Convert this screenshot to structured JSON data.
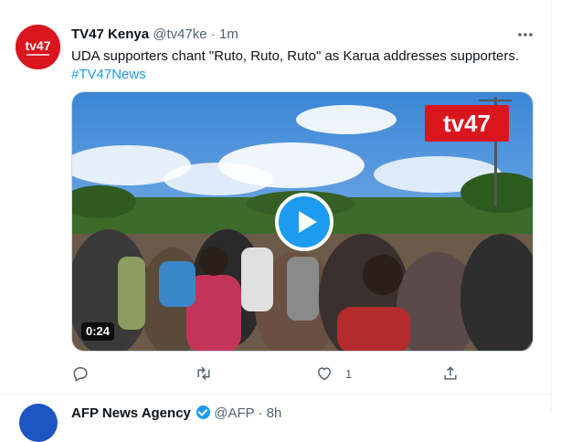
{
  "tweet": {
    "display_name": "TV47 Kenya",
    "handle": "@tv47ke",
    "separator": "·",
    "time": "1m",
    "text": "UDA supporters chant \"Ruto, Ruto, Ruto\" as Karua addresses supporters.",
    "hashtag": "#TV47News",
    "avatar_logo_text": "tv47",
    "more_icon": "more-options-icon",
    "video": {
      "duration": "0:24",
      "watermark_text": "tv47",
      "play_icon": "play-icon"
    },
    "actions": {
      "reply_icon": "reply-icon",
      "retweet_icon": "retweet-icon",
      "like_icon": "heart-icon",
      "like_count": "1",
      "share_icon": "share-icon"
    }
  },
  "next_tweet": {
    "display_name": "AFP News Agency",
    "handle": "@AFP",
    "separator": "·",
    "time": "8h"
  },
  "colors": {
    "accent": "#1d9bf0",
    "text": "#0f1419",
    "muted": "#536471",
    "brand_red": "#d9161e"
  }
}
